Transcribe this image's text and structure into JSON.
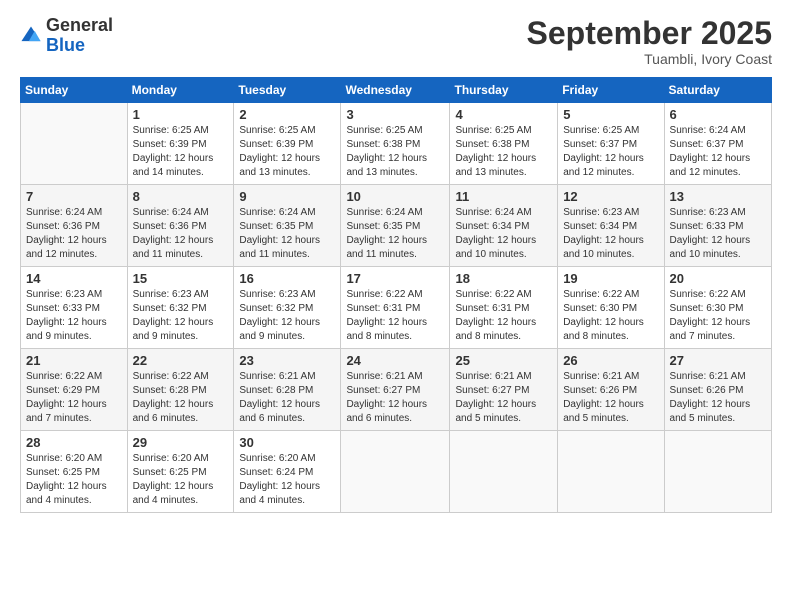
{
  "header": {
    "logo_general": "General",
    "logo_blue": "Blue",
    "month_title": "September 2025",
    "location": "Tuambli, Ivory Coast"
  },
  "days_of_week": [
    "Sunday",
    "Monday",
    "Tuesday",
    "Wednesday",
    "Thursday",
    "Friday",
    "Saturday"
  ],
  "weeks": [
    [
      {
        "day": "",
        "info": ""
      },
      {
        "day": "1",
        "info": "Sunrise: 6:25 AM\nSunset: 6:39 PM\nDaylight: 12 hours\nand 14 minutes."
      },
      {
        "day": "2",
        "info": "Sunrise: 6:25 AM\nSunset: 6:39 PM\nDaylight: 12 hours\nand 13 minutes."
      },
      {
        "day": "3",
        "info": "Sunrise: 6:25 AM\nSunset: 6:38 PM\nDaylight: 12 hours\nand 13 minutes."
      },
      {
        "day": "4",
        "info": "Sunrise: 6:25 AM\nSunset: 6:38 PM\nDaylight: 12 hours\nand 13 minutes."
      },
      {
        "day": "5",
        "info": "Sunrise: 6:25 AM\nSunset: 6:37 PM\nDaylight: 12 hours\nand 12 minutes."
      },
      {
        "day": "6",
        "info": "Sunrise: 6:24 AM\nSunset: 6:37 PM\nDaylight: 12 hours\nand 12 minutes."
      }
    ],
    [
      {
        "day": "7",
        "info": "Sunrise: 6:24 AM\nSunset: 6:36 PM\nDaylight: 12 hours\nand 12 minutes."
      },
      {
        "day": "8",
        "info": "Sunrise: 6:24 AM\nSunset: 6:36 PM\nDaylight: 12 hours\nand 11 minutes."
      },
      {
        "day": "9",
        "info": "Sunrise: 6:24 AM\nSunset: 6:35 PM\nDaylight: 12 hours\nand 11 minutes."
      },
      {
        "day": "10",
        "info": "Sunrise: 6:24 AM\nSunset: 6:35 PM\nDaylight: 12 hours\nand 11 minutes."
      },
      {
        "day": "11",
        "info": "Sunrise: 6:24 AM\nSunset: 6:34 PM\nDaylight: 12 hours\nand 10 minutes."
      },
      {
        "day": "12",
        "info": "Sunrise: 6:23 AM\nSunset: 6:34 PM\nDaylight: 12 hours\nand 10 minutes."
      },
      {
        "day": "13",
        "info": "Sunrise: 6:23 AM\nSunset: 6:33 PM\nDaylight: 12 hours\nand 10 minutes."
      }
    ],
    [
      {
        "day": "14",
        "info": "Sunrise: 6:23 AM\nSunset: 6:33 PM\nDaylight: 12 hours\nand 9 minutes."
      },
      {
        "day": "15",
        "info": "Sunrise: 6:23 AM\nSunset: 6:32 PM\nDaylight: 12 hours\nand 9 minutes."
      },
      {
        "day": "16",
        "info": "Sunrise: 6:23 AM\nSunset: 6:32 PM\nDaylight: 12 hours\nand 9 minutes."
      },
      {
        "day": "17",
        "info": "Sunrise: 6:22 AM\nSunset: 6:31 PM\nDaylight: 12 hours\nand 8 minutes."
      },
      {
        "day": "18",
        "info": "Sunrise: 6:22 AM\nSunset: 6:31 PM\nDaylight: 12 hours\nand 8 minutes."
      },
      {
        "day": "19",
        "info": "Sunrise: 6:22 AM\nSunset: 6:30 PM\nDaylight: 12 hours\nand 8 minutes."
      },
      {
        "day": "20",
        "info": "Sunrise: 6:22 AM\nSunset: 6:30 PM\nDaylight: 12 hours\nand 7 minutes."
      }
    ],
    [
      {
        "day": "21",
        "info": "Sunrise: 6:22 AM\nSunset: 6:29 PM\nDaylight: 12 hours\nand 7 minutes."
      },
      {
        "day": "22",
        "info": "Sunrise: 6:22 AM\nSunset: 6:28 PM\nDaylight: 12 hours\nand 6 minutes."
      },
      {
        "day": "23",
        "info": "Sunrise: 6:21 AM\nSunset: 6:28 PM\nDaylight: 12 hours\nand 6 minutes."
      },
      {
        "day": "24",
        "info": "Sunrise: 6:21 AM\nSunset: 6:27 PM\nDaylight: 12 hours\nand 6 minutes."
      },
      {
        "day": "25",
        "info": "Sunrise: 6:21 AM\nSunset: 6:27 PM\nDaylight: 12 hours\nand 5 minutes."
      },
      {
        "day": "26",
        "info": "Sunrise: 6:21 AM\nSunset: 6:26 PM\nDaylight: 12 hours\nand 5 minutes."
      },
      {
        "day": "27",
        "info": "Sunrise: 6:21 AM\nSunset: 6:26 PM\nDaylight: 12 hours\nand 5 minutes."
      }
    ],
    [
      {
        "day": "28",
        "info": "Sunrise: 6:20 AM\nSunset: 6:25 PM\nDaylight: 12 hours\nand 4 minutes."
      },
      {
        "day": "29",
        "info": "Sunrise: 6:20 AM\nSunset: 6:25 PM\nDaylight: 12 hours\nand 4 minutes."
      },
      {
        "day": "30",
        "info": "Sunrise: 6:20 AM\nSunset: 6:24 PM\nDaylight: 12 hours\nand 4 minutes."
      },
      {
        "day": "",
        "info": ""
      },
      {
        "day": "",
        "info": ""
      },
      {
        "day": "",
        "info": ""
      },
      {
        "day": "",
        "info": ""
      }
    ]
  ]
}
